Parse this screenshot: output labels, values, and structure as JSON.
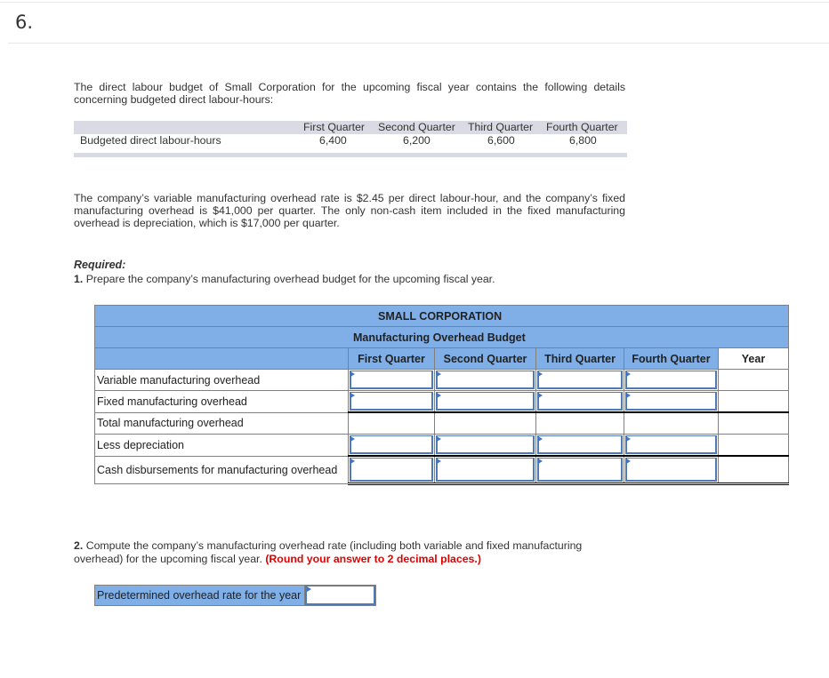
{
  "question": {
    "number": "6."
  },
  "intro": {
    "text": "The direct labour budget of Small Corporation for the upcoming fiscal year contains the following details concerning budgeted direct labour-hours:"
  },
  "given_table": {
    "headers": [
      "First Quarter",
      "Second Quarter",
      "Third Quarter",
      "Fourth Quarter"
    ],
    "row_label": "Budgeted direct labour-hours",
    "values": [
      "6,400",
      "6,200",
      "6,600",
      "6,800"
    ]
  },
  "details": {
    "text": "The company’s variable manufacturing overhead rate is $2.45 per direct labour-hour, and the company’s fixed manufacturing overhead is $41,000 per quarter. The only non-cash item included in the fixed manufacturing overhead is depreciation, which is $17,000 per quarter."
  },
  "required": {
    "heading": "Required:",
    "part1_number": "1.",
    "part1_text": "Prepare the company’s manufacturing overhead budget for the upcoming fiscal year.",
    "part2_number": "2.",
    "part2_text": "Compute the company’s manufacturing overhead rate (including both variable and fixed manufacturing overhead) for the upcoming fiscal year.",
    "part2_note": "(Round your answer to 2 decimal places.)"
  },
  "budget_table": {
    "company": "SMALL CORPORATION",
    "title": "Manufacturing Overhead Budget",
    "columns": [
      "First Quarter",
      "Second Quarter",
      "Third Quarter",
      "Fourth Quarter",
      "Year"
    ],
    "rows": [
      {
        "label": "Variable manufacturing overhead",
        "inputs": [
          "",
          "",
          "",
          ""
        ],
        "year": ""
      },
      {
        "label": "Fixed manufacturing overhead",
        "inputs": [
          "",
          "",
          "",
          ""
        ],
        "year": ""
      },
      {
        "label": "Total manufacturing overhead",
        "inputs": null,
        "year": ""
      },
      {
        "label": "Less depreciation",
        "inputs": [
          "",
          "",
          "",
          ""
        ],
        "year": ""
      },
      {
        "label": "Cash disbursements for manufacturing overhead",
        "inputs": [
          "",
          "",
          "",
          ""
        ],
        "year": ""
      }
    ]
  },
  "rate_field": {
    "label": "Predetermined overhead rate for the year",
    "value": ""
  },
  "colors": {
    "header_blue": "#7fafe6",
    "input_border": "#4f7ab8",
    "note_red": "#e00000",
    "given_header_gray": "#d8dbe3"
  }
}
